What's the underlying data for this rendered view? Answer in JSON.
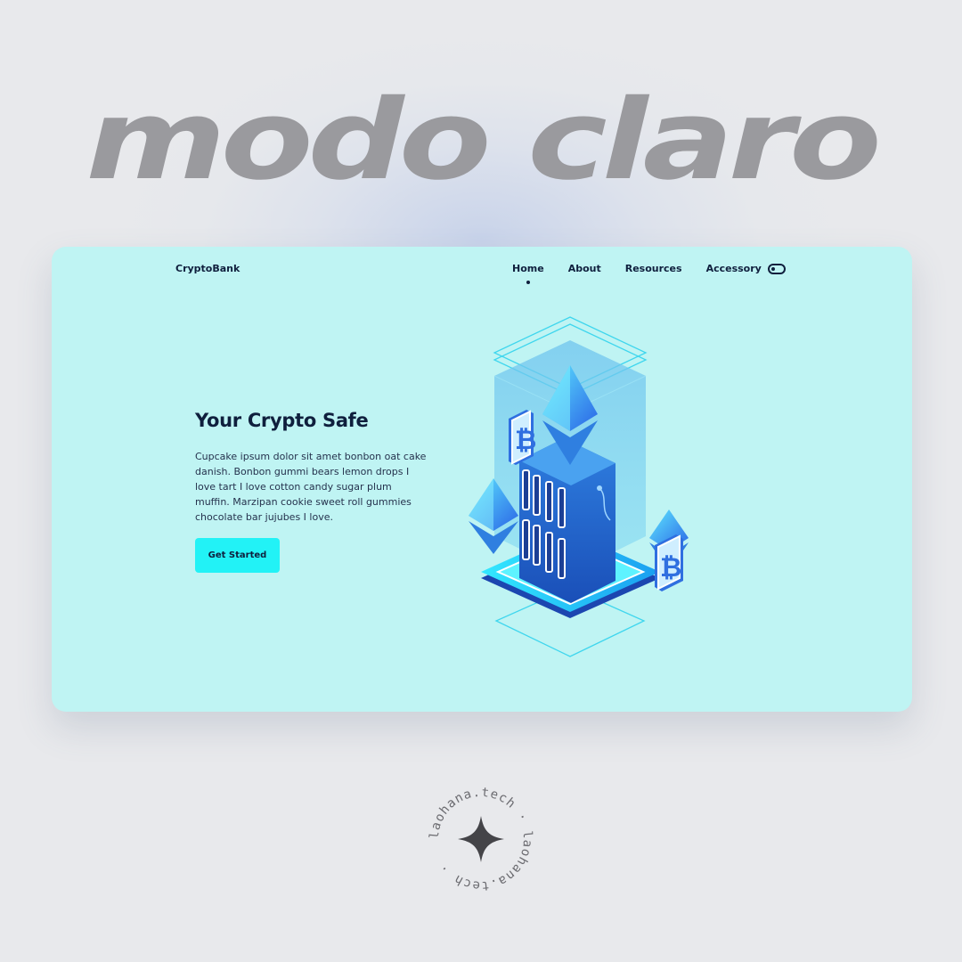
{
  "headline": "modo claro",
  "site": {
    "brand": "CryptoBank",
    "nav": [
      {
        "label": "Home",
        "active": true
      },
      {
        "label": "About",
        "active": false
      },
      {
        "label": "Resources",
        "active": false
      },
      {
        "label": "Accessory",
        "active": false
      }
    ],
    "theme_toggle_icon": "toggle-icon"
  },
  "hero": {
    "title": "Your Crypto Safe",
    "body": "Cupcake ipsum dolor sit amet bonbon oat cake danish. Bonbon gummi bears lemon drops I love tart I love cotton candy sugar plum muffin. Marzipan cookie sweet roll gummies chocolate bar jujubes I love.",
    "cta_label": "Get Started"
  },
  "illustration": {
    "icons": [
      "ethereum-icon",
      "bitcoin-icon",
      "server-icon"
    ]
  },
  "watermark": {
    "text": "laohana.tech · laohana.tech ·",
    "icon": "sparkle-icon"
  },
  "colors": {
    "card_bg": "#bff4f3",
    "accent": "#22f2f6",
    "text_dark": "#0f1f3d",
    "headline": "#9a9a9e"
  }
}
